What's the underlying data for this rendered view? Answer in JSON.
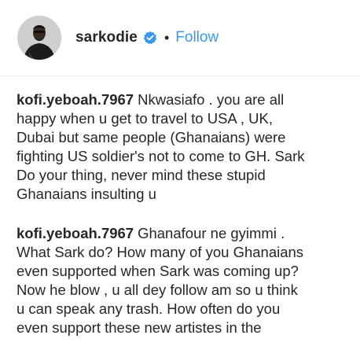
{
  "post_header": {
    "username": "sarkodie",
    "separator": "•",
    "follow_label": "Follow",
    "verified_icon": "verified-badge-icon",
    "accent_color": "#3897f0"
  },
  "comments": [
    {
      "author": "kofi.yeboah.7967",
      "lines": [
        "Nkwasiafo . you are all",
        "happy when u get to travel to USA , UK,",
        "Dubai but same people (Ghanaians) were",
        "fighting US soldier's not to come to GH. Sark",
        "Do your thing, never mind these stupid",
        "Ghanaians insulting u"
      ]
    },
    {
      "author": "kofi.yeboah.7967",
      "lines": [
        "Ghanafour ne gyimmi .",
        "What Sark do? How many of you Ghanaians",
        "even supported when Sark was coming up?",
        "Now he blow , u all dey follow am so u think",
        "u can speak any trash. How often do you",
        "even support these new artistes in the"
      ]
    }
  ]
}
